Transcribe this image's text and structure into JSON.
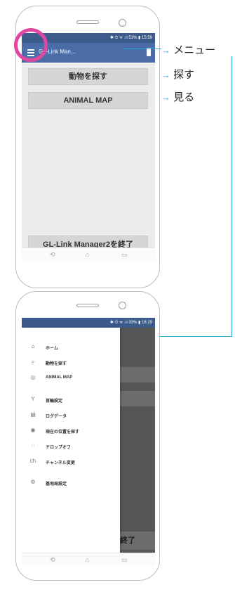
{
  "top_phone": {
    "status": "✱ ⏱ ᯤ .ıl 51% ▮ 15:59",
    "app_title": "GL-Link Man...",
    "buttons": {
      "search_animals": "動物を探す",
      "animal_map": "ANIMAL MAP",
      "exit": "GL-Link Manager2を終了"
    }
  },
  "annotations": {
    "menu": "メニュー",
    "search": "探す",
    "view": "見る",
    "arrow": "→",
    "left_arrow": "←"
  },
  "bottom_phone": {
    "status": "✱ ⏱ ᯤ .ıl 33% ▮ 16:29",
    "exit_partial": "終了",
    "menu_items": [
      {
        "icon": "⌂",
        "label": "ホーム"
      },
      {
        "icon": "⌕",
        "label": "動物を探す"
      },
      {
        "icon": "◎",
        "label": "ANIMAL MAP"
      },
      {
        "icon": "Y",
        "label": "首輪設定"
      },
      {
        "icon": "▤",
        "label": "ログデータ"
      },
      {
        "icon": "◉",
        "label": "現在の位置を探す"
      },
      {
        "icon": "◌",
        "label": "ドロップオフ"
      },
      {
        "icon": "ch",
        "label": "チャンネル変更"
      },
      {
        "icon": "⚙",
        "label": "基地局設定"
      }
    ]
  },
  "colors": {
    "accent": "#2aa6d9",
    "appbar": "#4a6da7",
    "highlight_circle": "#e0479e"
  }
}
